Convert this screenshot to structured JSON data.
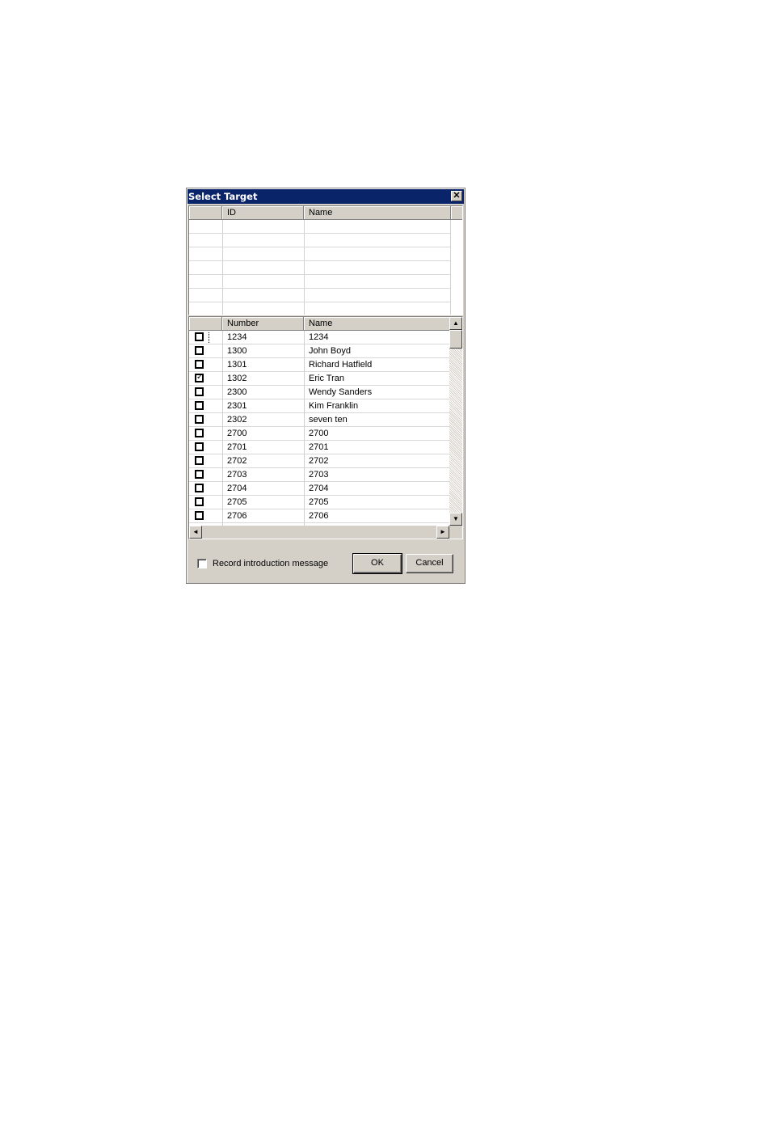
{
  "dialog": {
    "title": "Select Target",
    "close_glyph": "✕"
  },
  "top_grid": {
    "columns": [
      "",
      "ID",
      "Name"
    ],
    "empty_rows": 7
  },
  "list": {
    "columns": [
      "",
      "Number",
      "Name"
    ],
    "rows": [
      {
        "checked": false,
        "number": "1234",
        "name": "1234"
      },
      {
        "checked": false,
        "number": "1300",
        "name": "John Boyd"
      },
      {
        "checked": false,
        "number": "1301",
        "name": "Richard Hatfield"
      },
      {
        "checked": true,
        "number": "1302",
        "name": "Eric Tran"
      },
      {
        "checked": false,
        "number": "2300",
        "name": "Wendy Sanders"
      },
      {
        "checked": false,
        "number": "2301",
        "name": "Kim Franklin"
      },
      {
        "checked": false,
        "number": "2302",
        "name": "seven ten"
      },
      {
        "checked": false,
        "number": "2700",
        "name": "2700"
      },
      {
        "checked": false,
        "number": "2701",
        "name": "2701"
      },
      {
        "checked": false,
        "number": "2702",
        "name": "2702"
      },
      {
        "checked": false,
        "number": "2703",
        "name": "2703"
      },
      {
        "checked": false,
        "number": "2704",
        "name": "2704"
      },
      {
        "checked": false,
        "number": "2705",
        "name": "2705"
      },
      {
        "checked": false,
        "number": "2706",
        "name": "2706"
      }
    ],
    "scroll_up_glyph": "▲",
    "scroll_down_glyph": "▼",
    "scroll_left_glyph": "◄",
    "scroll_right_glyph": "►"
  },
  "footer": {
    "record_label": "Record introduction message",
    "record_checked": false,
    "ok_label": "OK",
    "cancel_label": "Cancel"
  }
}
